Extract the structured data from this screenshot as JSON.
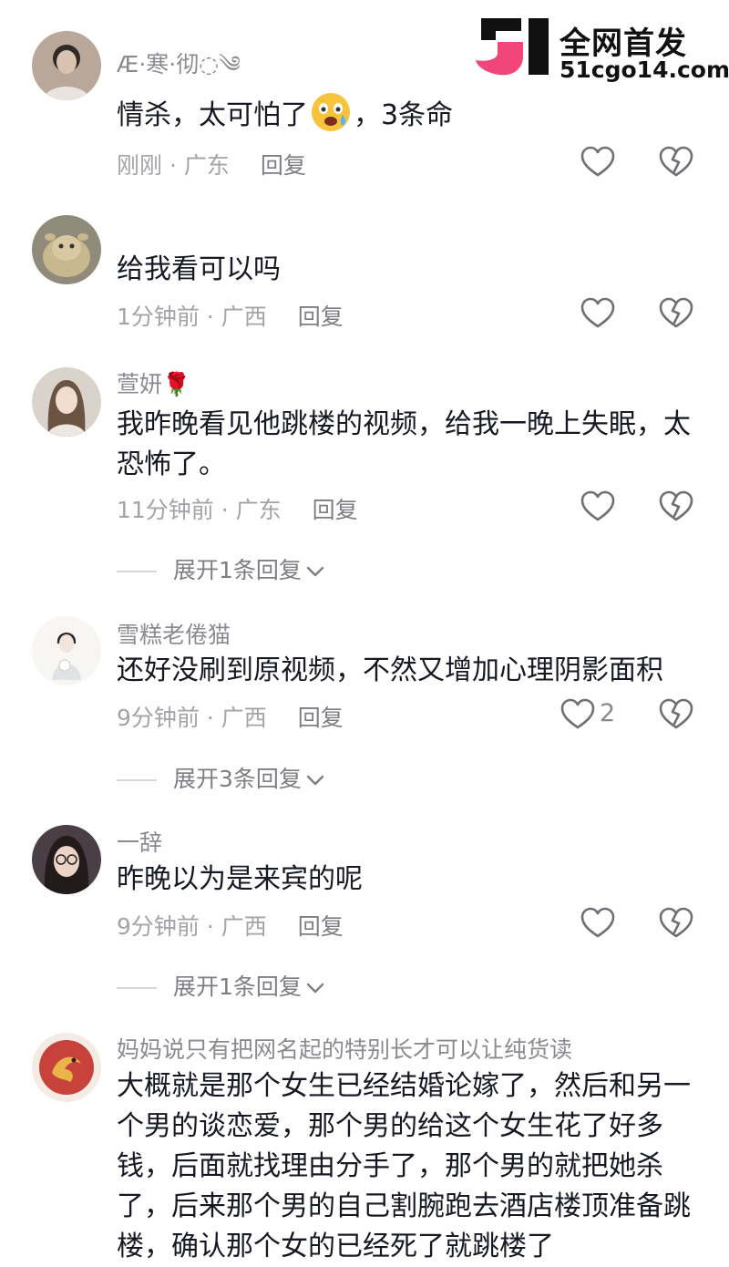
{
  "watermark": {
    "title": "全网首发",
    "url": "51cgo14.com"
  },
  "comments": [
    {
      "username": "Æ·寒·彻◌༄",
      "text_before": "情杀，太可怕了",
      "emoji": "scared-face",
      "text_after": "，3条命",
      "time": "刚刚",
      "location": "广东",
      "reply": "回复"
    },
    {
      "username": "",
      "text": "给我看可以吗",
      "time": "1分钟前",
      "location": "广西",
      "reply": "回复"
    },
    {
      "username": "萱妍🌹",
      "text": "我昨晚看见他跳楼的视频，给我一晚上失眠，太恐怖了。",
      "time": "11分钟前",
      "location": "广东",
      "reply": "回复",
      "expand": "展开1条回复"
    },
    {
      "username": "雪糕老倦猫",
      "text": "还好没刷到原视频，不然又增加心理阴影面积",
      "time": "9分钟前",
      "location": "广西",
      "reply": "回复",
      "likes": "2",
      "expand": "展开3条回复"
    },
    {
      "username": "一辞",
      "text": "昨晚以为是来宾的呢",
      "time": "9分钟前",
      "location": "广西",
      "reply": "回复",
      "expand": "展开1条回复"
    },
    {
      "username": "妈妈说只有把网名起的特别长才可以让纯货读",
      "text": "大概就是那个女生已经结婚论嫁了，然后和另一个男的谈恋爱，那个男的给这个女生花了好多钱，后面就找理由分手了，那个男的就把她杀了，后来那个男的自己割腕跑去酒店楼顶准备跳楼，确认那个女的已经死了就跳楼了"
    }
  ],
  "separator": " · ",
  "colors": {
    "text": "#161823",
    "secondary": "#8a8b91",
    "brand_pink": "#f2457a",
    "icon": "#6f7076"
  }
}
